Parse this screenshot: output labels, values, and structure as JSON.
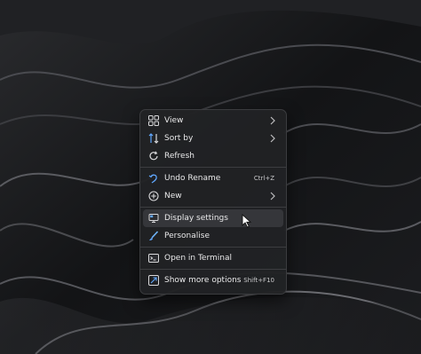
{
  "desktop": {
    "wallpaper_icon": "abstract-waves-wallpaper"
  },
  "context_menu": {
    "items": [
      {
        "label": "View",
        "icon": "grid-icon",
        "has_submenu": true
      },
      {
        "label": "Sort by",
        "icon": "sort-arrows-icon",
        "has_submenu": true
      },
      {
        "label": "Refresh",
        "icon": "refresh-icon"
      },
      {
        "label": "Undo Rename",
        "icon": "undo-icon",
        "shortcut": "Ctrl+Z"
      },
      {
        "label": "New",
        "icon": "plus-circle-icon",
        "has_submenu": true
      },
      {
        "label": "Display settings",
        "icon": "display-icon",
        "highlighted": true
      },
      {
        "label": "Personalise",
        "icon": "brush-icon"
      },
      {
        "label": "Open in Terminal",
        "icon": "terminal-icon"
      },
      {
        "label": "Show more options",
        "icon": "more-options-icon",
        "shortcut": "Shift+F10"
      }
    ]
  },
  "colors": {
    "menu_bg": "#212224",
    "menu_text": "#e9e9ea",
    "hover_bg": "#35363a",
    "accent_blue": "#60a8ff"
  }
}
